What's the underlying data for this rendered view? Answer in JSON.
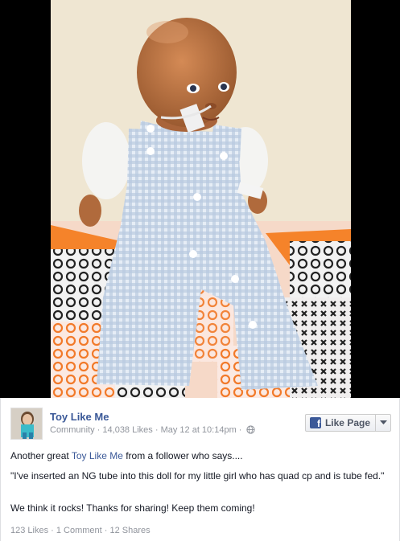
{
  "post": {
    "page_name": "Toy Like Me",
    "category": "Community",
    "likes_count": "14,038 Likes",
    "date": "May 12 at 10:14pm",
    "like_page_label": "Like Page",
    "intro_before": "Another great ",
    "intro_link": "Toy Like Me",
    "intro_after": " from a follower who says....",
    "quote": "\"I've inserted an NG tube into this doll for my little girl who has quad cp and is tube fed.\"",
    "closing": "We think it rocks! Thanks for sharing! Keep them coming!",
    "stat_likes": "123 Likes",
    "stat_comments": "1 Comment",
    "stat_shares": "12 Shares",
    "separator": " · "
  },
  "icons": {
    "fb": "facebook-f-icon",
    "globe": "globe-icon",
    "caret": "chevron-down-icon"
  },
  "colors": {
    "link": "#3b5998",
    "meta": "#90949c",
    "text": "#141823"
  }
}
